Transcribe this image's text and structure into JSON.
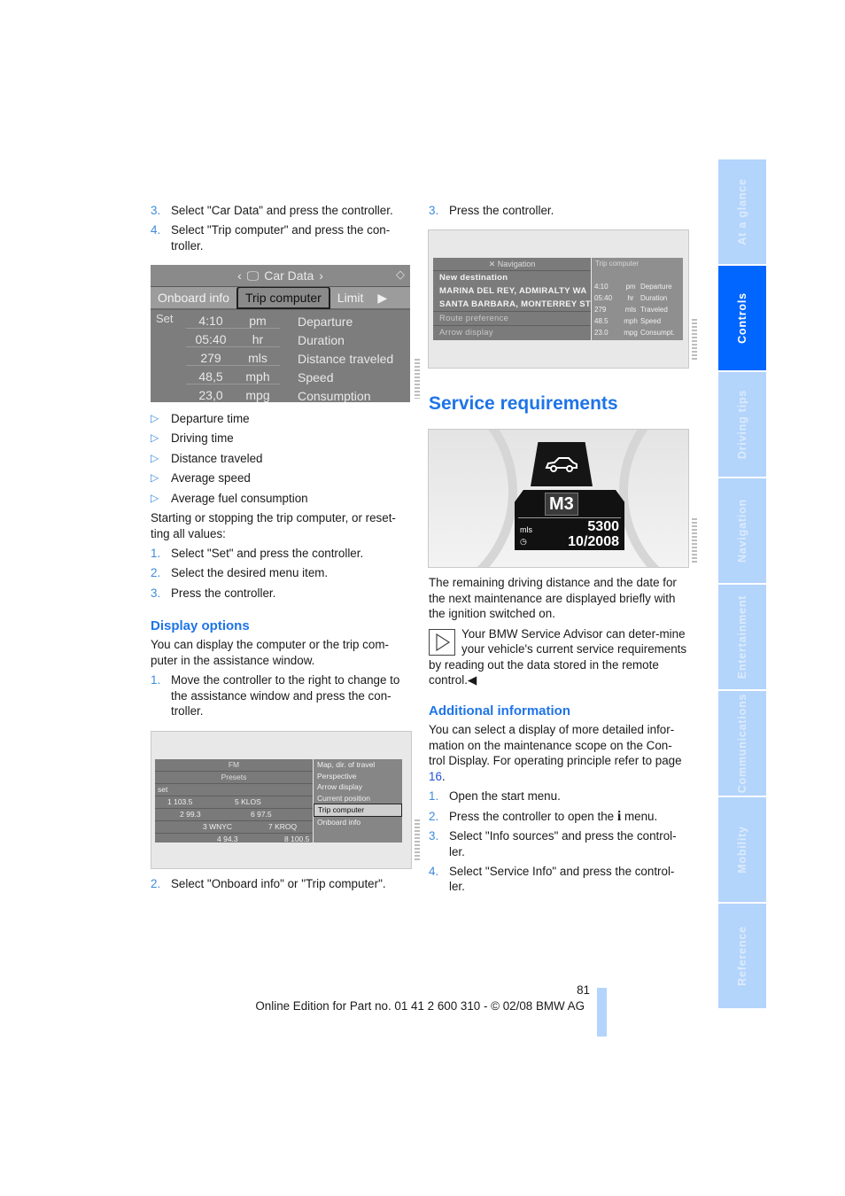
{
  "left_column": {
    "steps_top": [
      {
        "num": "3.",
        "text": "Select \"Car Data\" and press the controller."
      },
      {
        "num": "4.",
        "text": "Select \"Trip computer\" and press the con-troller."
      }
    ],
    "car_data_screen": {
      "title": "Car Data",
      "tabs": [
        "Onboard info",
        "Trip computer",
        "Limit"
      ],
      "active_tab": "Trip computer",
      "set_label": "Set",
      "rows": [
        {
          "value": "4:10",
          "unit": "pm",
          "label": "Departure"
        },
        {
          "value": "05:40",
          "unit": "hr",
          "label": "Duration"
        },
        {
          "value": "279",
          "unit": "mls",
          "label": "Distance traveled"
        },
        {
          "value": "48,5",
          "unit": "mph",
          "label": "Speed"
        },
        {
          "value": "23,0",
          "unit": "mpg",
          "label": "Consumption"
        }
      ]
    },
    "bullets": [
      "Departure time",
      "Driving time",
      "Distance traveled",
      "Average speed",
      "Average fuel consumption"
    ],
    "reset_intro": "Starting or stopping the trip computer, or reset-ting all values:",
    "reset_steps": [
      {
        "num": "1.",
        "text": "Select \"Set\" and press the controller."
      },
      {
        "num": "2.",
        "text": "Select the desired menu item."
      },
      {
        "num": "3.",
        "text": "Press the controller."
      }
    ],
    "display_options": {
      "heading": "Display options",
      "intro": "You can display the computer or the trip com-puter in the assistance window.",
      "step1": {
        "num": "1.",
        "text": "Move the controller to the right to change to the assistance window and press the con-troller."
      }
    },
    "radio_screen": {
      "header": "FM",
      "presets_label": "Presets",
      "set_label": "set",
      "stations": [
        [
          "1 103.5",
          "5 KLOS"
        ],
        [
          "2 99.3",
          "6 97.5"
        ],
        [
          "3 WNYC",
          "7 KROQ"
        ],
        [
          "4 94.3",
          "8 100.5"
        ]
      ],
      "menu_items": [
        "Map, dir. of travel",
        "Perspective",
        "Arrow display",
        "Current position",
        "Trip computer",
        "Onboard info"
      ],
      "selected_item": "Trip computer"
    },
    "step_bottom": {
      "num": "2.",
      "text": "Select \"Onboard info\" or \"Trip computer\"."
    }
  },
  "right_column": {
    "step_top": {
      "num": "3.",
      "text": "Press the controller."
    },
    "nav_screen": {
      "header": "Navigation",
      "lines": [
        "New destination",
        "MARINA DEL REY, ADMIRALTY WA",
        "SANTA BARBARA, MONTERREY ST"
      ],
      "dim_lines": [
        "Route preference",
        "Arrow display"
      ],
      "trip_header": "Trip computer",
      "trip_rows": [
        [
          "4:10",
          "pm",
          "Departure"
        ],
        [
          "05:40",
          "hr",
          "Duration"
        ],
        [
          "279",
          "mls",
          "Traveled"
        ],
        [
          "48.5",
          "mph",
          "Speed"
        ],
        [
          "23.0",
          "mpg",
          "Consumpt."
        ]
      ]
    },
    "section_title": "Service requirements",
    "cluster": {
      "model": "M3",
      "distance_unit": "mls",
      "distance": "5300",
      "date": "10/2008",
      "icon": "car-service-icon"
    },
    "service_text": "The remaining driving distance and the date for the next maintenance are displayed briefly with the ignition switched on.",
    "note_text": "Your BMW Service Advisor can deter-mine your vehicle's current service requirements by reading out the data stored in the remote control.",
    "note_end": "◀",
    "additional": {
      "heading": "Additional information",
      "text_before": "You can select a display of more detailed infor-mation on the maintenance scope on the Con-trol Display. For operating principle refer to page ",
      "page_link": "16",
      "text_after": ".",
      "steps": [
        {
          "num": "1.",
          "text": "Open the start menu."
        },
        {
          "num": "2.",
          "text_before": "Press the controller to open the ",
          "icon": "i",
          "text_after": " menu."
        },
        {
          "num": "3.",
          "text": "Select \"Info sources\" and press the control-ler."
        },
        {
          "num": "4.",
          "text": "Select \"Service Info\" and press the control-ler."
        }
      ]
    }
  },
  "side_tabs": [
    {
      "label": "At a glance",
      "active": false
    },
    {
      "label": "Controls",
      "active": true
    },
    {
      "label": "Driving tips",
      "active": false
    },
    {
      "label": "Navigation",
      "active": false
    },
    {
      "label": "Entertainment",
      "active": false
    },
    {
      "label": "Communications",
      "active": false
    },
    {
      "label": "Mobility",
      "active": false
    },
    {
      "label": "Reference",
      "active": false
    }
  ],
  "footer": {
    "page_number": "81",
    "edition": "Online Edition for Part no. 01 41 2 600 310 - © 02/08 BMW AG"
  },
  "colors": {
    "accent_blue": "#1e74e8",
    "tab_active": "#0066ff",
    "tab_inactive": "#b3d4fb"
  }
}
